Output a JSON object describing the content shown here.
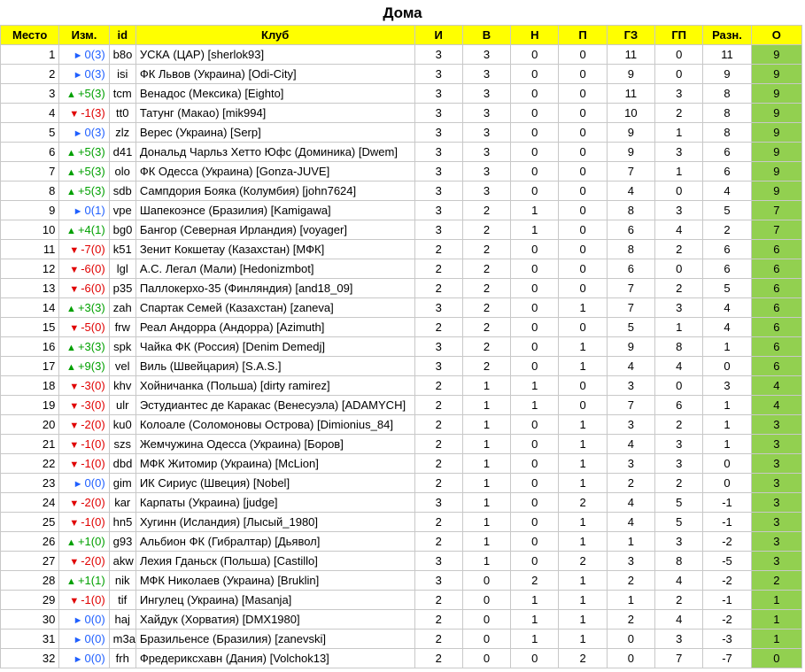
{
  "title": "Дома",
  "headers": [
    "Место",
    "Изм.",
    "id",
    "Клуб",
    "И",
    "В",
    "Н",
    "П",
    "ГЗ",
    "ГП",
    "Разн.",
    "О"
  ],
  "rows": [
    {
      "place": "1",
      "dir": "same",
      "change": "0(3)",
      "id": "b8o",
      "club": "УСКА (ЦАР) [sherlok93]",
      "g": "3",
      "w": "3",
      "d": "0",
      "l": "0",
      "gf": "11",
      "ga": "0",
      "diff": "11",
      "pts": "9"
    },
    {
      "place": "2",
      "dir": "same",
      "change": "0(3)",
      "id": "isi",
      "club": "ФК Львов (Украина) [Odi-City]",
      "g": "3",
      "w": "3",
      "d": "0",
      "l": "0",
      "gf": "9",
      "ga": "0",
      "diff": "9",
      "pts": "9"
    },
    {
      "place": "3",
      "dir": "up",
      "change": "+5(3)",
      "id": "tcm",
      "club": "Венадос (Мексика) [Eighto]",
      "g": "3",
      "w": "3",
      "d": "0",
      "l": "0",
      "gf": "11",
      "ga": "3",
      "diff": "8",
      "pts": "9"
    },
    {
      "place": "4",
      "dir": "down",
      "change": "-1(3)",
      "id": "tt0",
      "club": "Татунг (Макао) [mik994]",
      "g": "3",
      "w": "3",
      "d": "0",
      "l": "0",
      "gf": "10",
      "ga": "2",
      "diff": "8",
      "pts": "9"
    },
    {
      "place": "5",
      "dir": "same",
      "change": "0(3)",
      "id": "zlz",
      "club": "Верес (Украина) [Serp]",
      "g": "3",
      "w": "3",
      "d": "0",
      "l": "0",
      "gf": "9",
      "ga": "1",
      "diff": "8",
      "pts": "9"
    },
    {
      "place": "6",
      "dir": "up",
      "change": "+5(3)",
      "id": "d41",
      "club": "Дональд Чарльз Хетто Юфс (Доминика) [Dwem]",
      "g": "3",
      "w": "3",
      "d": "0",
      "l": "0",
      "gf": "9",
      "ga": "3",
      "diff": "6",
      "pts": "9"
    },
    {
      "place": "7",
      "dir": "up",
      "change": "+5(3)",
      "id": "olo",
      "club": "ФК Одесса (Украина) [Gonza-JUVE]",
      "g": "3",
      "w": "3",
      "d": "0",
      "l": "0",
      "gf": "7",
      "ga": "1",
      "diff": "6",
      "pts": "9"
    },
    {
      "place": "8",
      "dir": "up",
      "change": "+5(3)",
      "id": "sdb",
      "club": "Сампдория Бояка (Колумбия) [john7624]",
      "g": "3",
      "w": "3",
      "d": "0",
      "l": "0",
      "gf": "4",
      "ga": "0",
      "diff": "4",
      "pts": "9"
    },
    {
      "place": "9",
      "dir": "same",
      "change": "0(1)",
      "id": "vpe",
      "club": "Шапекоэнсе (Бразилия) [Kamigawa]",
      "g": "3",
      "w": "2",
      "d": "1",
      "l": "0",
      "gf": "8",
      "ga": "3",
      "diff": "5",
      "pts": "7"
    },
    {
      "place": "10",
      "dir": "up",
      "change": "+4(1)",
      "id": "bg0",
      "club": "Бангор (Северная Ирландия) [voyager]",
      "g": "3",
      "w": "2",
      "d": "1",
      "l": "0",
      "gf": "6",
      "ga": "4",
      "diff": "2",
      "pts": "7"
    },
    {
      "place": "11",
      "dir": "down",
      "change": "-7(0)",
      "id": "k51",
      "club": "Зенит Кокшетау (Казахстан) [МФК]",
      "g": "2",
      "w": "2",
      "d": "0",
      "l": "0",
      "gf": "8",
      "ga": "2",
      "diff": "6",
      "pts": "6"
    },
    {
      "place": "12",
      "dir": "down",
      "change": "-6(0)",
      "id": "lgl",
      "club": "А.С. Легал (Мали) [Hedonizmbot]",
      "g": "2",
      "w": "2",
      "d": "0",
      "l": "0",
      "gf": "6",
      "ga": "0",
      "diff": "6",
      "pts": "6"
    },
    {
      "place": "13",
      "dir": "down",
      "change": "-6(0)",
      "id": "p35",
      "club": "Паллокерхо-35 (Финляндия) [and18_09]",
      "g": "2",
      "w": "2",
      "d": "0",
      "l": "0",
      "gf": "7",
      "ga": "2",
      "diff": "5",
      "pts": "6"
    },
    {
      "place": "14",
      "dir": "up",
      "change": "+3(3)",
      "id": "zah",
      "club": "Спартак Семей (Казахстан) [zaneva]",
      "g": "3",
      "w": "2",
      "d": "0",
      "l": "1",
      "gf": "7",
      "ga": "3",
      "diff": "4",
      "pts": "6"
    },
    {
      "place": "15",
      "dir": "down",
      "change": "-5(0)",
      "id": "frw",
      "club": "Реал Андорра (Андорра) [Azimuth]",
      "g": "2",
      "w": "2",
      "d": "0",
      "l": "0",
      "gf": "5",
      "ga": "1",
      "diff": "4",
      "pts": "6"
    },
    {
      "place": "16",
      "dir": "up",
      "change": "+3(3)",
      "id": "spk",
      "club": "Чайка ФК (Россия) [Denim Demedj]",
      "g": "3",
      "w": "2",
      "d": "0",
      "l": "1",
      "gf": "9",
      "ga": "8",
      "diff": "1",
      "pts": "6"
    },
    {
      "place": "17",
      "dir": "up",
      "change": "+9(3)",
      "id": "vel",
      "club": "Виль (Швейцария) [S.A.S.]",
      "g": "3",
      "w": "2",
      "d": "0",
      "l": "1",
      "gf": "4",
      "ga": "4",
      "diff": "0",
      "pts": "6"
    },
    {
      "place": "18",
      "dir": "down",
      "change": "-3(0)",
      "id": "khv",
      "club": "Хойничанка (Польша) [dirty ramirez]",
      "g": "2",
      "w": "1",
      "d": "1",
      "l": "0",
      "gf": "3",
      "ga": "0",
      "diff": "3",
      "pts": "4"
    },
    {
      "place": "19",
      "dir": "down",
      "change": "-3(0)",
      "id": "ulr",
      "club": "Эстудиантес де Каракас (Венесуэла) [ADAMYCH]",
      "g": "2",
      "w": "1",
      "d": "1",
      "l": "0",
      "gf": "7",
      "ga": "6",
      "diff": "1",
      "pts": "4"
    },
    {
      "place": "20",
      "dir": "down",
      "change": "-2(0)",
      "id": "ku0",
      "club": "Колоале (Соломоновы Острова) [Dimionius_84]",
      "g": "2",
      "w": "1",
      "d": "0",
      "l": "1",
      "gf": "3",
      "ga": "2",
      "diff": "1",
      "pts": "3"
    },
    {
      "place": "21",
      "dir": "down",
      "change": "-1(0)",
      "id": "szs",
      "club": "Жемчужина Одесса (Украина) [Боров]",
      "g": "2",
      "w": "1",
      "d": "0",
      "l": "1",
      "gf": "4",
      "ga": "3",
      "diff": "1",
      "pts": "3"
    },
    {
      "place": "22",
      "dir": "down",
      "change": "-1(0)",
      "id": "dbd",
      "club": "МФК Житомир (Украина) [McLion]",
      "g": "2",
      "w": "1",
      "d": "0",
      "l": "1",
      "gf": "3",
      "ga": "3",
      "diff": "0",
      "pts": "3"
    },
    {
      "place": "23",
      "dir": "same",
      "change": "0(0)",
      "id": "gim",
      "club": "ИК Сириус (Швеция) [Nobel]",
      "g": "2",
      "w": "1",
      "d": "0",
      "l": "1",
      "gf": "2",
      "ga": "2",
      "diff": "0",
      "pts": "3"
    },
    {
      "place": "24",
      "dir": "down",
      "change": "-2(0)",
      "id": "kar",
      "club": "Карпаты (Украина) [judge]",
      "g": "3",
      "w": "1",
      "d": "0",
      "l": "2",
      "gf": "4",
      "ga": "5",
      "diff": "-1",
      "pts": "3"
    },
    {
      "place": "25",
      "dir": "down",
      "change": "-1(0)",
      "id": "hn5",
      "club": "Хугинн (Исландия) [Лысый_1980]",
      "g": "2",
      "w": "1",
      "d": "0",
      "l": "1",
      "gf": "4",
      "ga": "5",
      "diff": "-1",
      "pts": "3"
    },
    {
      "place": "26",
      "dir": "up",
      "change": "+1(0)",
      "id": "g93",
      "club": "Альбион ФК (Гибралтар) [Дьявол]",
      "g": "2",
      "w": "1",
      "d": "0",
      "l": "1",
      "gf": "1",
      "ga": "3",
      "diff": "-2",
      "pts": "3"
    },
    {
      "place": "27",
      "dir": "down",
      "change": "-2(0)",
      "id": "akw",
      "club": "Лехия Гданьск (Польша) [Castillo]",
      "g": "3",
      "w": "1",
      "d": "0",
      "l": "2",
      "gf": "3",
      "ga": "8",
      "diff": "-5",
      "pts": "3"
    },
    {
      "place": "28",
      "dir": "up",
      "change": "+1(1)",
      "id": "nik",
      "club": "МФК Николаев (Украина) [Bruklin]",
      "g": "3",
      "w": "0",
      "d": "2",
      "l": "1",
      "gf": "2",
      "ga": "4",
      "diff": "-2",
      "pts": "2"
    },
    {
      "place": "29",
      "dir": "down",
      "change": "-1(0)",
      "id": "tif",
      "club": "Ингулец (Украина) [Masanja]",
      "g": "2",
      "w": "0",
      "d": "1",
      "l": "1",
      "gf": "1",
      "ga": "2",
      "diff": "-1",
      "pts": "1"
    },
    {
      "place": "30",
      "dir": "same",
      "change": "0(0)",
      "id": "haj",
      "club": "Хайдук (Хорватия) [DMX1980]",
      "g": "2",
      "w": "0",
      "d": "1",
      "l": "1",
      "gf": "2",
      "ga": "4",
      "diff": "-2",
      "pts": "1"
    },
    {
      "place": "31",
      "dir": "same",
      "change": "0(0)",
      "id": "m3a",
      "club": "Бразильенсе (Бразилия) [zanevski]",
      "g": "2",
      "w": "0",
      "d": "1",
      "l": "1",
      "gf": "0",
      "ga": "3",
      "diff": "-3",
      "pts": "1"
    },
    {
      "place": "32",
      "dir": "same",
      "change": "0(0)",
      "id": "frh",
      "club": "Фредериксхавн (Дания) [Volchok13]",
      "g": "2",
      "w": "0",
      "d": "0",
      "l": "2",
      "gf": "0",
      "ga": "7",
      "diff": "-7",
      "pts": "0"
    }
  ],
  "icons": {
    "up": "triangle-up-icon",
    "down": "triangle-down-icon",
    "same": "arrow-right-icon"
  },
  "colors": {
    "header_bg": "#ffff00",
    "points_bg": "#92d050",
    "up": "#00a000",
    "down": "#e00000",
    "same": "#1f5fff"
  }
}
